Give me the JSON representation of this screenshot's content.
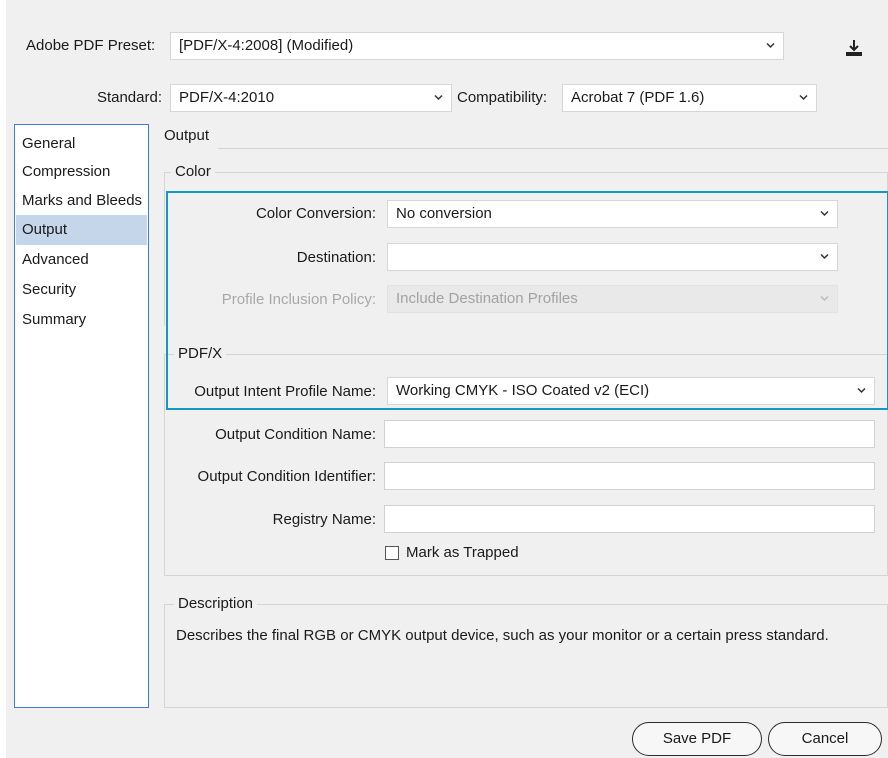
{
  "header": {
    "preset_label": "Adobe PDF Preset:",
    "preset_value": "[PDF/X-4:2008] (Modified)",
    "standard_label": "Standard:",
    "standard_value": "PDF/X-4:2010",
    "compatibility_label": "Compatibility:",
    "compatibility_value": "Acrobat 7 (PDF 1.6)"
  },
  "sidebar": {
    "items": [
      {
        "label": "General",
        "active": false
      },
      {
        "label": "Compression",
        "active": false
      },
      {
        "label": "Marks and Bleeds",
        "active": false
      },
      {
        "label": "Output",
        "active": true
      },
      {
        "label": "Advanced",
        "active": false
      },
      {
        "label": "Security",
        "active": false
      },
      {
        "label": "Summary",
        "active": false
      }
    ]
  },
  "panel": {
    "title": "Output",
    "color_group": {
      "title": "Color",
      "conversion_label": "Color Conversion:",
      "conversion_value": "No conversion",
      "destination_label": "Destination:",
      "destination_value": "",
      "profile_policy_label": "Profile Inclusion Policy:",
      "profile_policy_value": "Include Destination Profiles"
    },
    "pdfx_group": {
      "title": "PDF/X",
      "intent_label": "Output Intent Profile Name:",
      "intent_value": "Working CMYK -  ISO Coated v2 (ECI)",
      "condition_name_label": "Output Condition Name:",
      "condition_name_value": "",
      "condition_id_label": "Output Condition Identifier:",
      "condition_id_value": "",
      "registry_label": "Registry Name:",
      "registry_value": "",
      "trapped_label": "Mark as Trapped",
      "trapped_checked": false
    },
    "description": {
      "title": "Description",
      "text": "Describes the final RGB or CMYK output device, such as your monitor or a certain press standard."
    }
  },
  "buttons": {
    "save": "Save PDF",
    "cancel": "Cancel"
  },
  "colors": {
    "highlight": "#1597c4",
    "sidebar_active": "#c6d6ea",
    "sidebar_border": "#3a7fd5"
  },
  "icons": {
    "save_preset": "download-tray-icon",
    "dropdown": "chevron-down-icon"
  }
}
